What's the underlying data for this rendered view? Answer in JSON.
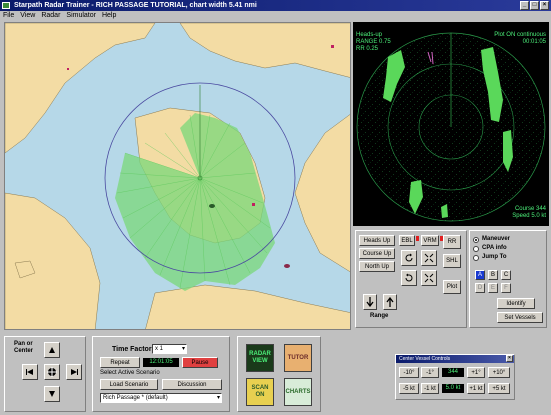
{
  "window": {
    "title": "Starpath Radar Trainer - RICH PASSAGE   TUTORIAL, chart width 5.41 nmi"
  },
  "menu": [
    "File",
    "View",
    "Radar",
    "Simulator",
    "Help"
  ],
  "radar": {
    "mode": "Heads-up",
    "range": "RANGE 0.75",
    "rr": "RR 0.25",
    "plot": "Plot ON continuous",
    "elapsed": "00:01:05",
    "course": "Course 344",
    "speed": "Speed 5.0 kt"
  },
  "controls": {
    "heads_up": "Heads Up",
    "course_up": "Course Up",
    "north_up": "North Up",
    "ebl": "EBL",
    "vrm": "VRM",
    "rr_btn": "RR",
    "shl_btn": "SHL",
    "plot_btn": "Plot",
    "range_label": "Range",
    "maneuver": "Maneuver",
    "cpa_info": "CPA info",
    "jump_to": "Jump To",
    "vessel_letters": [
      "A",
      "B",
      "C",
      "D",
      "E",
      "F"
    ],
    "identify": "Identify",
    "set_vessels": "Set Vessels"
  },
  "pan": {
    "label_line1": "Pan or",
    "label_line2": "Center"
  },
  "time_panel": {
    "time_factor_label": "Time Factor",
    "time_factor_value": "x 1",
    "repeat": "Repeat",
    "clock": "12:01:05",
    "pause": "Pause",
    "select_scenario": "Select Active Scenario",
    "load_scenario": "Load Scenario",
    "discussion": "Discussion",
    "scenario_value": "Rich Passage   * (default)"
  },
  "tiles": {
    "radar_view": "RADAR VIEW",
    "tutor": "TUTOR",
    "scan_on": "SCAN ON",
    "charts": "CHARTS"
  },
  "cvc": {
    "title": "Center Vessel Controls",
    "course_buttons": [
      "-10°",
      "-1°",
      "344",
      "+1°",
      "+10°"
    ],
    "speed_buttons": [
      "-5 kt",
      "-1 kt",
      "5.0 kt",
      "+1 kt",
      "+5 kt"
    ]
  },
  "colors": {
    "radar_green": "#4cf07a",
    "land": "#f3dca4",
    "water": "#b6d8e8"
  }
}
